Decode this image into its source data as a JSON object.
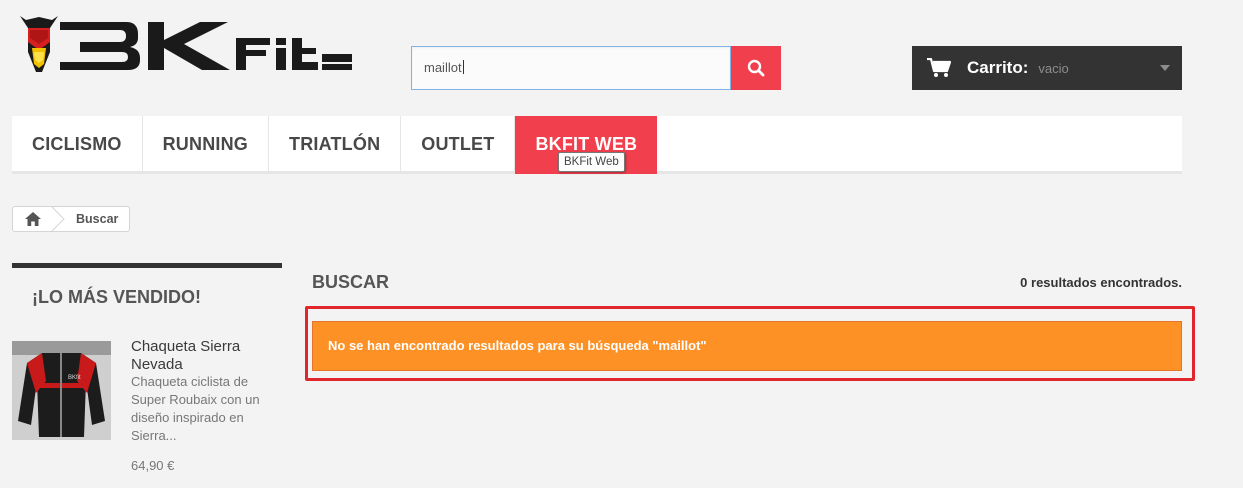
{
  "logo": {
    "text": "BKFit"
  },
  "search": {
    "value": "maillot"
  },
  "cart": {
    "label": "Carrito:",
    "status": "vacio"
  },
  "menu": {
    "items": [
      {
        "label": "Ciclismo"
      },
      {
        "label": "Running"
      },
      {
        "label": "Triatlón"
      },
      {
        "label": "Outlet"
      },
      {
        "label": "BKFit Web"
      }
    ],
    "active_index": 4,
    "tooltip": "BKFit Web"
  },
  "breadcrumb": {
    "current": "Buscar"
  },
  "sidebar": {
    "title": "¡Lo más vendido!",
    "product": {
      "name": "Chaqueta Sierra Nevada",
      "description": "Chaqueta ciclista de Super Roubaix con un diseño inspirado en Sierra...",
      "price": "64,90 €"
    }
  },
  "main": {
    "title": "Buscar",
    "result_count": "0 resultados encontrados.",
    "alert": "No se han encontrado resultados para su búsqueda \"maillot\""
  },
  "colors": {
    "accent": "#f13f4d",
    "alert": "#fe9126",
    "highlight": "#e0252b",
    "cart_bg": "#333333"
  }
}
